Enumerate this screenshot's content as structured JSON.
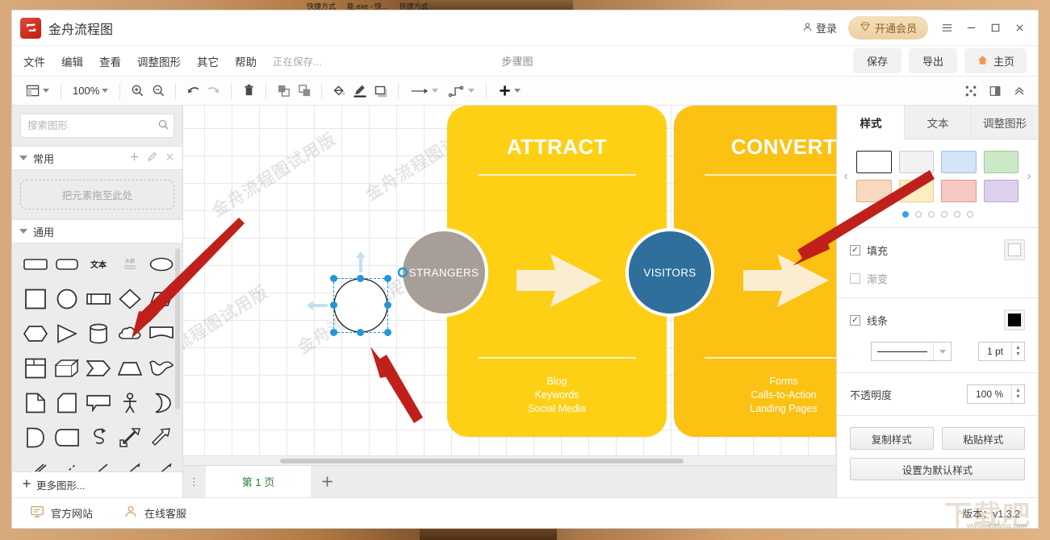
{
  "desktop": {
    "taskbar_items": [
      "快捷方式",
      "能.exe - 快...",
      "快捷方式"
    ]
  },
  "titlebar": {
    "app_name": "金舟流程图",
    "login_label": "登录",
    "vip_label": "开通会员",
    "menu_icon": "hamburger-icon",
    "minimize_icon": "minimize-icon",
    "maximize_icon": "maximize-icon",
    "close_icon": "close-icon"
  },
  "menubar": {
    "items": [
      "文件",
      "编辑",
      "查看",
      "调整图形",
      "其它",
      "帮助"
    ],
    "saving_status": "正在保存...",
    "document_title": "步骤图",
    "save_label": "保存",
    "export_label": "导出",
    "home_label": "主页"
  },
  "toolbar": {
    "layout_icon": "layout-panel-icon",
    "zoom_value": "100%",
    "zoom_in_icon": "zoom-in-icon",
    "zoom_out_icon": "zoom-out-icon",
    "undo_icon": "undo-icon",
    "redo_icon": "redo-icon",
    "delete_icon": "trash-icon",
    "bring_front_icon": "bring-to-front-icon",
    "send_back_icon": "send-to-back-icon",
    "fill_icon": "paint-bucket-icon",
    "line_icon": "pen-icon",
    "shadow_icon": "shadow-icon",
    "connector_straight_icon": "straight-arrow-icon",
    "connector_elbow_icon": "elbow-connector-icon",
    "add_icon": "plus-icon",
    "fullscreen_icon": "fullscreen-icon",
    "split_icon": "split-view-icon",
    "collapse_icon": "collapse-up-icon"
  },
  "left_panel": {
    "search_placeholder": "搜索图形",
    "search_value": "",
    "search_icon": "search-icon",
    "sections": [
      {
        "title": "常用",
        "add_icon": "plus-icon",
        "edit_icon": "pencil-icon",
        "close_icon": "close-icon",
        "dropzone_label": "把元素拖至此处"
      },
      {
        "title": "通用"
      }
    ],
    "shapes": [
      [
        "rounded-rect-wide",
        "rounded-rect",
        "text-shape",
        "header-text-shape",
        "ellipse"
      ],
      [
        "square",
        "circle",
        "process-bar",
        "diamond",
        "parallelogram"
      ],
      [
        "hexagon",
        "triangle",
        "cylinder",
        "cloud",
        "document-flag"
      ],
      [
        "table-grid",
        "cube",
        "chevron",
        "trapezoid",
        "wave"
      ],
      [
        "page-corner",
        "note",
        "speech-bubble",
        "stick-figure",
        "moon"
      ],
      [
        "half-disc",
        "card-wave",
        "curved-arrow",
        "double-arrow",
        "block-arrow"
      ],
      [
        "double-line",
        "dashed-line",
        "line",
        "double-head-arrow",
        "arrow-line"
      ]
    ],
    "more_shapes_label": "更多图形...",
    "more_shapes_icon": "plus-icon"
  },
  "canvas": {
    "watermark_text": "金舟流程图试用版",
    "selected_shape": {
      "name": "ellipse",
      "fill": "#ffffff",
      "stroke": "#111111"
    },
    "diagram": {
      "nodes": [
        {
          "label": "STRANGERS",
          "color": "#a89e98",
          "type": "circle"
        },
        {
          "label": "VISITORS",
          "color": "#2e709b",
          "type": "circle"
        }
      ],
      "cards": [
        {
          "title": "ATTRACT",
          "color": "#fdd015",
          "items": [
            "Blog",
            "Keywords",
            "Social Media"
          ]
        },
        {
          "title": "CONVERT",
          "color": "#fbc113",
          "items": [
            "Forms",
            "Calls-to-Action",
            "Landing Pages"
          ]
        }
      ],
      "arrow_color": "#fbeed0"
    }
  },
  "pagebar": {
    "menu_icon": "vertical-dots-icon",
    "page_label": "第 1 页",
    "add_page_icon": "plus-icon"
  },
  "right_panel": {
    "tabs": [
      {
        "label": "样式",
        "active": true
      },
      {
        "label": "文本",
        "active": false
      },
      {
        "label": "调整图形",
        "active": false
      }
    ],
    "prev_icon": "chevron-left-icon",
    "next_icon": "chevron-right-icon",
    "swatches": [
      {
        "fill": "#ffffff",
        "border": "#222222"
      },
      {
        "fill": "#f2f2f2",
        "border": "#cccccc"
      },
      {
        "fill": "#d6e4f7",
        "border": "#9fc0e8"
      },
      {
        "fill": "#cde8c6",
        "border": "#9dcb92"
      },
      {
        "fill": "#f8d9c0",
        "border": "#e0b07c"
      },
      {
        "fill": "#fdeec2",
        "border": "#e8cf84"
      },
      {
        "fill": "#f6c9c4",
        "border": "#e29a93"
      },
      {
        "fill": "#ddd0ec",
        "border": "#b9a4d6"
      }
    ],
    "page_dots": {
      "total": 6,
      "active_index": 0
    },
    "fill_label": "填充",
    "fill_checked": true,
    "fill_color": "#ffffff",
    "gradient_label": "渐变",
    "gradient_checked": false,
    "line_label": "线条",
    "line_checked": true,
    "line_color": "#000000",
    "line_width": "1 pt",
    "opacity_label": "不透明度",
    "opacity_value": "100 %",
    "copy_style_label": "复制样式",
    "paste_style_label": "粘贴样式",
    "default_style_label": "设置为默认样式"
  },
  "statusbar": {
    "website_label": "官方网站",
    "website_icon": "monitor-icon",
    "support_label": "在线客服",
    "support_icon": "person-icon",
    "version_label": "版本：v1.3.2",
    "watermark": "下载吧",
    "watermark_url": "www.xiazaiba.com"
  },
  "colors": {
    "accent_red": "#c8271b",
    "vip_gold": "#e9cfa0",
    "page_green": "#2f7d3c",
    "selection_blue": "#2196d8"
  }
}
